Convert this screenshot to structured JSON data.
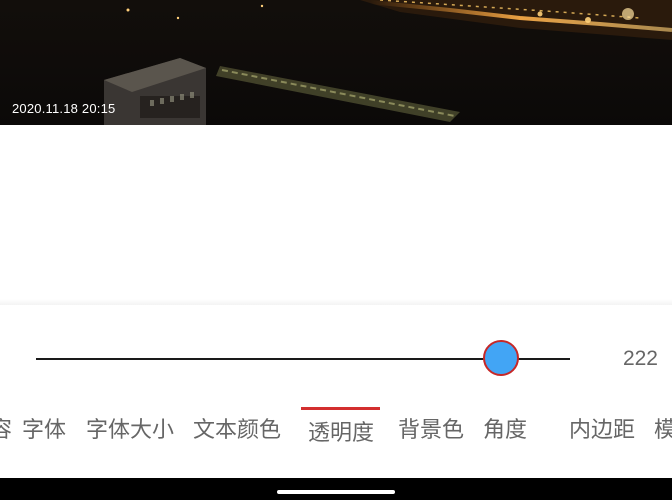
{
  "photo": {
    "timestamp": "2020.11.18 20:15"
  },
  "opacity_slider": {
    "value": 222,
    "max": 255,
    "value_label": "222",
    "thumb_color": "#42a5f5",
    "thumb_border_color": "#c62828"
  },
  "tabs": [
    {
      "label": "容",
      "active": false
    },
    {
      "label": "字体",
      "active": false
    },
    {
      "label": "字体大小",
      "active": false
    },
    {
      "label": "文本颜色",
      "active": false
    },
    {
      "label": "透明度",
      "active": true
    },
    {
      "label": "背景色",
      "active": false
    },
    {
      "label": "角度",
      "active": false
    },
    {
      "label": "内边距",
      "active": false
    },
    {
      "label": "模",
      "active": false
    }
  ],
  "colors": {
    "accent": "#d32f2f",
    "tab_text": "#666666",
    "background": "#ffffff"
  }
}
